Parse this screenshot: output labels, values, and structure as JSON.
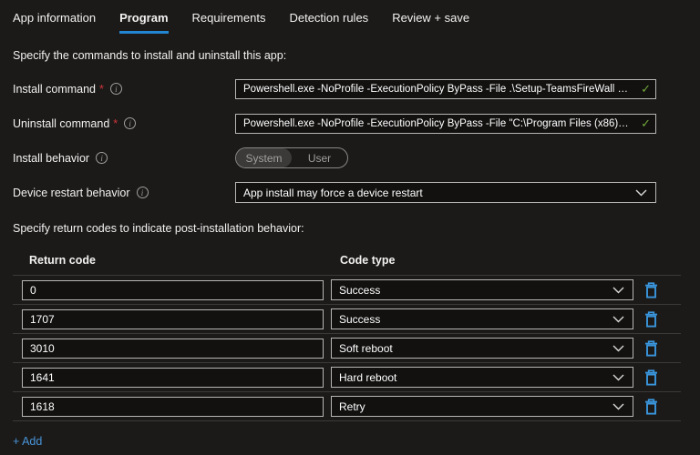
{
  "colors": {
    "background": "#1b1a19",
    "accent_blue": "#2386d3",
    "link_blue": "#4894d9",
    "valid_green": "#73a839",
    "required_red": "#d13438",
    "delete_icon_blue": "#3a96dd"
  },
  "icons": {
    "info_glyph": "i",
    "required_marker": "*",
    "valid_check": "✓"
  },
  "tabs": [
    {
      "label": "App information"
    },
    {
      "label": "Program"
    },
    {
      "label": "Requirements"
    },
    {
      "label": "Detection rules"
    },
    {
      "label": "Review + save"
    }
  ],
  "sections": {
    "commands_intro": "Specify the commands to install and uninstall this app:",
    "return_codes_intro": "Specify return codes to indicate post-installation behavior:"
  },
  "fields": {
    "install_command": {
      "label": "Install command",
      "value": "Powershell.exe -NoProfile -ExecutionPolicy ByPass -File .\\Setup-TeamsFireWall …"
    },
    "uninstall_command": {
      "label": "Uninstall command",
      "value": "Powershell.exe -NoProfile -ExecutionPolicy ByPass -File \"C:\\Program Files (x86)…"
    },
    "install_behavior": {
      "label": "Install behavior",
      "options": [
        "System",
        "User"
      ],
      "selected": "System"
    },
    "device_restart_behavior": {
      "label": "Device restart behavior",
      "value": "App install may force a device restart"
    }
  },
  "return_codes": {
    "headers": {
      "code": "Return code",
      "type": "Code type"
    },
    "rows": [
      {
        "code": "0",
        "type": "Success"
      },
      {
        "code": "1707",
        "type": "Success"
      },
      {
        "code": "3010",
        "type": "Soft reboot"
      },
      {
        "code": "1641",
        "type": "Hard reboot"
      },
      {
        "code": "1618",
        "type": "Retry"
      }
    ],
    "add_label": "+ Add"
  }
}
